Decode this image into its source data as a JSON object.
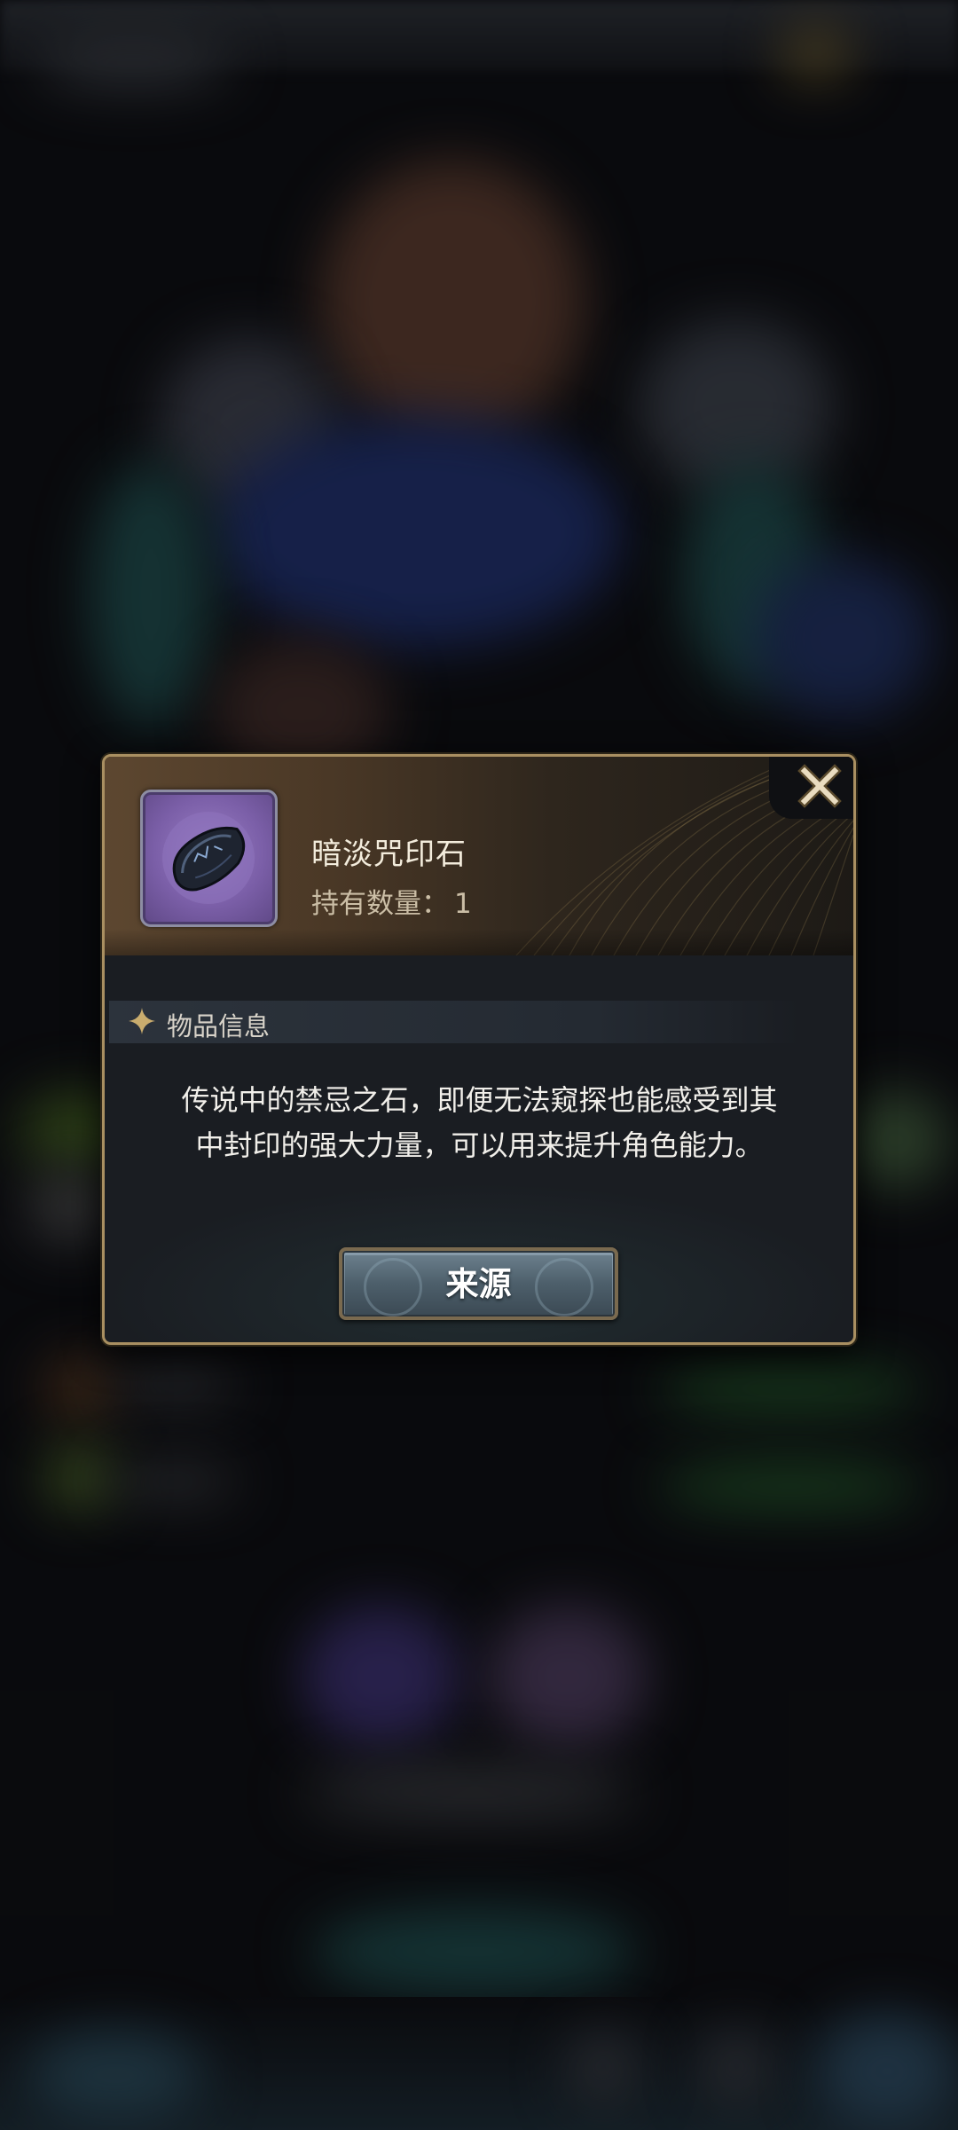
{
  "item": {
    "name": "暗淡咒印石",
    "count_label": "持有数量：",
    "count_value": "1",
    "icon": "dark-rune-stone-icon"
  },
  "section": {
    "title": "物品信息",
    "icon": "sparkle-star-icon"
  },
  "description": {
    "line1": "传说中的禁忌之石，即便无法窥探也能感受到其",
    "line2": "中封印的强大力量，可以用来提升角色能力。"
  },
  "actions": {
    "source_label": "来源",
    "close_icon": "close-x-icon"
  },
  "colors": {
    "frame_gold": "#a98f61",
    "item_purple": "#7b5fa8",
    "button_steel": "#4d5f6b"
  }
}
